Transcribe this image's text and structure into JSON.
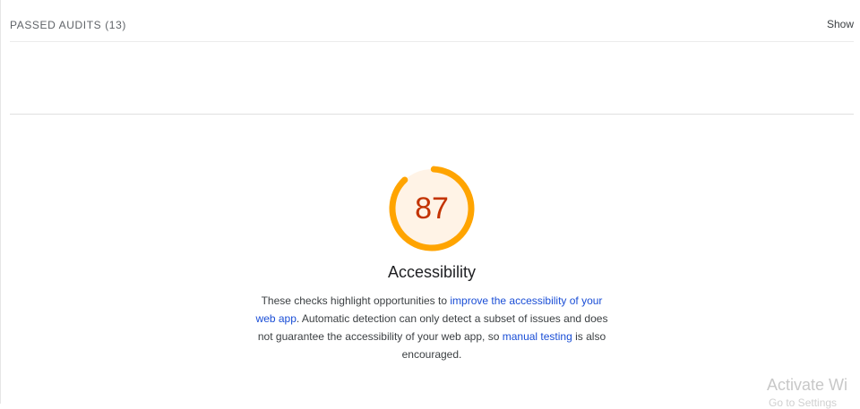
{
  "passed_audits": {
    "label": "PASSED AUDITS (13)",
    "toggle_label": "Show"
  },
  "category": {
    "score": "87",
    "score_fraction": 0.87,
    "score_color": "#ffa400",
    "score_text_color": "#c33300",
    "gauge_fill_color": "#fff3e6",
    "title": "Accessibility",
    "description": {
      "part1": "These checks highlight opportunities to ",
      "link1": "improve the accessibility of your web app",
      "part2": ". Automatic detection can only detect a subset of issues and does not guarantee the accessibility of your web app, so ",
      "link2": "manual testing",
      "part3": " is also encouraged."
    }
  },
  "watermark": {
    "title": "Activate Wi",
    "subtitle": "Go to Settings"
  }
}
